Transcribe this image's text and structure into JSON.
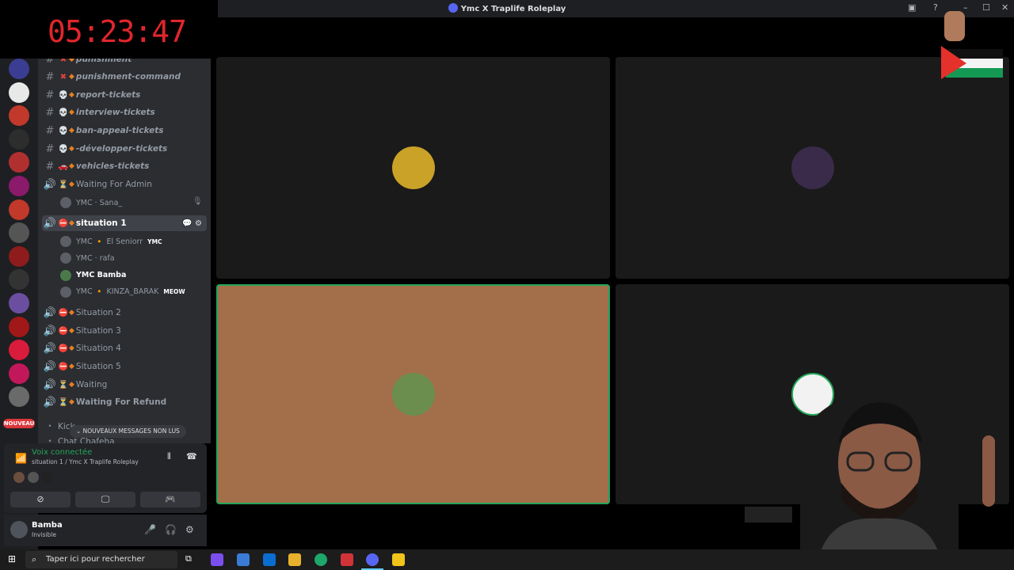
{
  "window": {
    "title": "Ymc X Traplife Roleplay",
    "minimize": "–",
    "maximize": "☐",
    "close": "✕"
  },
  "timer": "05:23:47",
  "servers": {
    "nouveau_badge": "NOUVEAU",
    "colors": [
      "#3a3d91",
      "#e8e8e8",
      "#c0392b",
      "#2d2d2d",
      "#b03030",
      "#8b1a6b",
      "#c0392b",
      "#555",
      "#8e1c1c",
      "#333",
      "#6b4ea0",
      "#a01818",
      "#d91c3c",
      "#c2185b",
      "#6a6a6a"
    ]
  },
  "channels": [
    {
      "type": "text",
      "emoji": "✖",
      "name": "punishment"
    },
    {
      "type": "text",
      "emoji": "✖",
      "name": "punishment-command"
    },
    {
      "type": "text",
      "emoji": "💀",
      "name": "report-tickets"
    },
    {
      "type": "text",
      "emoji": "💀",
      "name": "interview-tickets"
    },
    {
      "type": "text",
      "emoji": "💀",
      "name": "ban-appeal-tickets"
    },
    {
      "type": "text",
      "emoji": "💀",
      "name": "-développer-tickets"
    },
    {
      "type": "text",
      "emoji": "🚗",
      "name": "vehicles-tickets"
    },
    {
      "type": "voice",
      "emoji": "⏳",
      "name": "Waiting For Admin"
    }
  ],
  "waiting_member": "YMC · Sana_",
  "active_channel": "situation 1",
  "situation_members": [
    {
      "name": "YMC 🔸 El Seniorr",
      "tag": "YMC"
    },
    {
      "name": "YMC · rafa",
      "tag": ""
    },
    {
      "name": "YMC   Bamba",
      "tag": ""
    },
    {
      "name": "YMC 🔸 KINZA_BARAK",
      "tag": "MEOW"
    }
  ],
  "voice_channels": [
    "Situation 2",
    "Situation 3",
    "Situation 4",
    "Situation 5",
    "Waiting",
    "Waiting For Refund"
  ],
  "kick_channel": "Kick",
  "chat_channel": "Chat Chafeha",
  "new_messages": "NOUVEAUX MESSAGES NON LUS",
  "voice_panel": {
    "status": "Voix connectée",
    "location": "situation 1 / Ymc X Traplife Roleplay"
  },
  "user_panel": {
    "name": "Bamba",
    "status": "Invisible"
  },
  "taskbar": {
    "search_placeholder": "Taper ici pour rechercher"
  },
  "tiles": [
    {
      "avatar_color": "#c9a227"
    },
    {
      "avatar_color": "#3a2b4a"
    },
    {
      "avatar_color": "#6b8e4e"
    },
    {
      "avatar_color": "#f2f2f2"
    }
  ],
  "colors": {
    "accent_green": "#23a55a",
    "speaking_bg": "#a36e4a",
    "timer_red": "#e0262c",
    "diamond": "#e67e22"
  }
}
